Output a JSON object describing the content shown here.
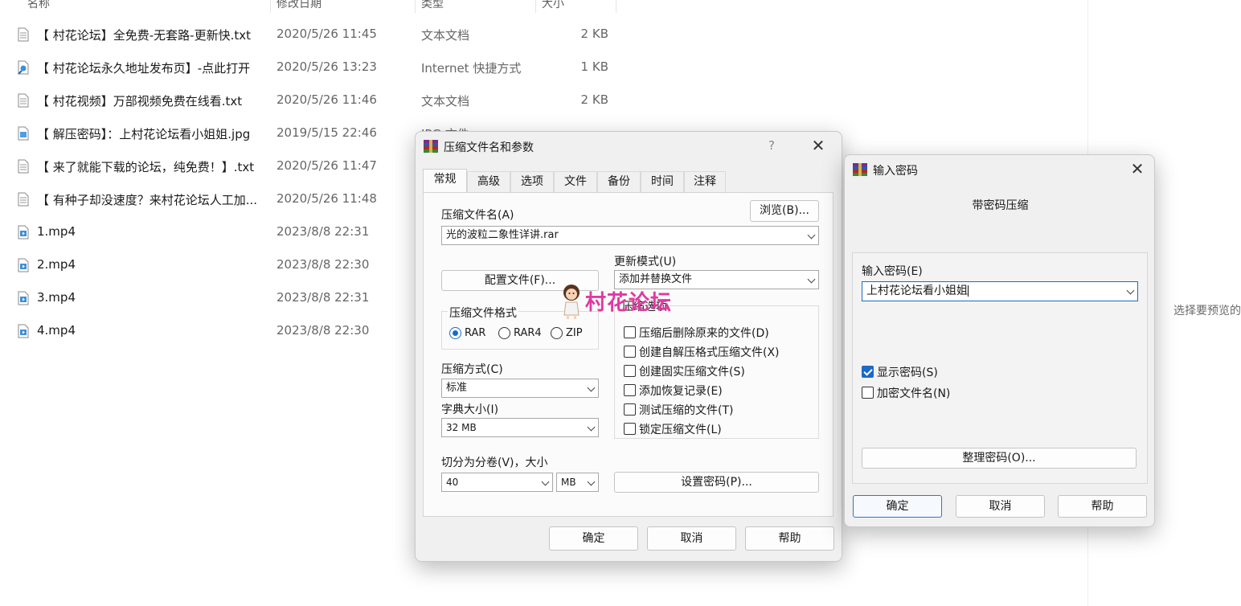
{
  "explorer": {
    "columns": {
      "name": "名称",
      "date": "修改日期",
      "type": "类型",
      "size": "大小"
    },
    "files": [
      {
        "name": "【 村花论坛】全免费-无套路-更新快.txt",
        "date": "2020/5/26 11:45",
        "type": "文本文档",
        "size": "2 KB",
        "icon": "text-file-icon"
      },
      {
        "name": "【 村花论坛永久地址发布页】-点此打开",
        "date": "2020/5/26 13:23",
        "type": "Internet 快捷方式",
        "size": "1 KB",
        "icon": "shortcut-icon"
      },
      {
        "name": "【 村花视频】万部视频免费在线看.txt",
        "date": "2020/5/26 11:46",
        "type": "文本文档",
        "size": "2 KB",
        "icon": "text-file-icon"
      },
      {
        "name": "【 解压密码】：上村花论坛看小姐姐.jpg",
        "date": "2019/5/15 22:46",
        "type": "JPG 文件",
        "size": "",
        "icon": "image-file-icon"
      },
      {
        "name": "【 来了就能下载的论坛，纯免费！】.txt",
        "date": "2020/5/26 11:47",
        "type": "",
        "size": "",
        "icon": "text-file-icon"
      },
      {
        "name": "【 有种子却没速度？来村花论坛人工加...",
        "date": "2020/5/26 11:48",
        "type": "",
        "size": "",
        "icon": "text-file-icon"
      },
      {
        "name": "1.mp4",
        "date": "2023/8/8 22:31",
        "type": "",
        "size": "",
        "icon": "video-file-icon"
      },
      {
        "name": "2.mp4",
        "date": "2023/8/8 22:30",
        "type": "",
        "size": "",
        "icon": "video-file-icon"
      },
      {
        "name": "3.mp4",
        "date": "2023/8/8 22:31",
        "type": "",
        "size": "",
        "icon": "video-file-icon"
      },
      {
        "name": "4.mp4",
        "date": "2023/8/8 22:30",
        "type": "",
        "size": "",
        "icon": "video-file-icon"
      }
    ],
    "preview_text": "选择要预览的"
  },
  "archive_dialog": {
    "title": "压缩文件名和参数",
    "help": "?",
    "close": "✕",
    "tabs": [
      "常规",
      "高级",
      "选项",
      "文件",
      "备份",
      "时间",
      "注释"
    ],
    "active_tab": "常规",
    "archive_name_label": "压缩文件名(A)",
    "browse_button": "浏览(B)...",
    "archive_name_value": "光的波粒二象性详讲.rar",
    "profiles_button": "配置文件(F)...",
    "update_mode_label": "更新模式(U)",
    "update_mode_value": "添加并替换文件",
    "format_label": "压缩文件格式",
    "formats": [
      "RAR",
      "RAR4",
      "ZIP"
    ],
    "selected_format": "RAR",
    "method_label": "压缩方式(C)",
    "method_value": "标准",
    "dict_label": "字典大小(I)",
    "dict_value": "32 MB",
    "split_label": "切分为分卷(V)，大小",
    "split_value": "40",
    "split_unit": "MB",
    "options_label": "压缩选项",
    "options": [
      {
        "label": "压缩后删除原来的文件(D)",
        "checked": false
      },
      {
        "label": "创建自解压格式压缩文件(X)",
        "checked": false
      },
      {
        "label": "创建固实压缩文件(S)",
        "checked": false
      },
      {
        "label": "添加恢复记录(E)",
        "checked": false
      },
      {
        "label": "测试压缩的文件(T)",
        "checked": false
      },
      {
        "label": "锁定压缩文件(L)",
        "checked": false
      }
    ],
    "set_password_button": "设置密码(P)...",
    "ok_button": "确定",
    "cancel_button": "取消",
    "help_button": "帮助"
  },
  "password_dialog": {
    "title": "输入密码",
    "close": "✕",
    "heading": "带密码压缩",
    "password_label": "输入密码(E)",
    "password_value": "上村花论坛看小姐姐",
    "show_password_label": "显示密码(S)",
    "show_password_checked": true,
    "encrypt_names_label": "加密文件名(N)",
    "encrypt_names_checked": false,
    "organize_button": "整理密码(O)...",
    "ok_button": "确定",
    "cancel_button": "取消",
    "help_button": "帮助"
  },
  "watermark": {
    "text": "村花论坛",
    "color": "#e03aa0"
  },
  "colors": {
    "accent": "#1b6ac9",
    "winrar_red": "#b4262a",
    "winrar_blue": "#2a5aa8"
  }
}
